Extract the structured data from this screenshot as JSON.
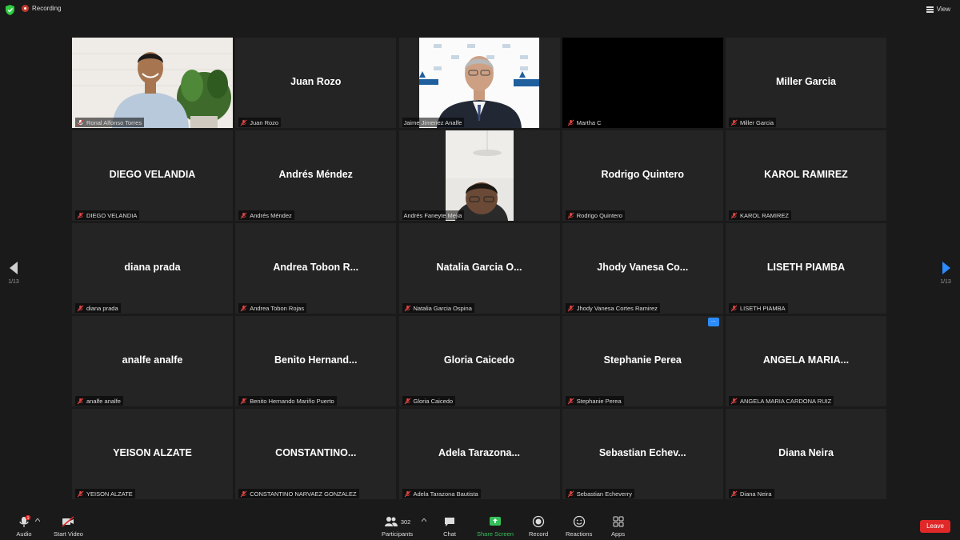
{
  "topbar": {
    "recording_label": "Recording",
    "view_label": "View"
  },
  "pager": {
    "page_left": "1/13",
    "page_right": "1/13"
  },
  "tiles": [
    {
      "big": "",
      "caption": "Ronal Alfonso Torres",
      "video": "ronal",
      "active": true,
      "mic": "on"
    },
    {
      "big": "Juan Rozo",
      "caption": "Juan Rozo",
      "mic": "off"
    },
    {
      "big": "",
      "caption": "Jaime Jimenez Analfe",
      "video": "jaime",
      "mic": "none"
    },
    {
      "big": "",
      "caption": "Martha C",
      "video": "black",
      "mic": "off"
    },
    {
      "big": "Miller Garcia",
      "caption": "Miller Garcia",
      "mic": "off"
    },
    {
      "big": "DIEGO VELANDIA",
      "caption": "DIEGO VELANDIA",
      "mic": "off"
    },
    {
      "big": "Andrés Méndez",
      "caption": "Andrés Méndez",
      "mic": "off"
    },
    {
      "big": "",
      "caption": "Andrés Faneyte Mejia",
      "video": "andres",
      "mic": "none"
    },
    {
      "big": "Rodrigo Quintero",
      "caption": "Rodrigo Quintero",
      "mic": "off"
    },
    {
      "big": "KAROL RAMIREZ",
      "caption": "KAROL RAMIREZ",
      "mic": "off"
    },
    {
      "big": "diana prada",
      "caption": "diana prada",
      "mic": "off"
    },
    {
      "big": "Andrea Tobon R...",
      "caption": "Andrea Tobon Rojas",
      "mic": "off"
    },
    {
      "big": "Natalia Garcia O...",
      "caption": "Natalia Garcia Ospina",
      "mic": "off"
    },
    {
      "big": "Jhody Vanesa Co...",
      "caption": "Jhody Vanesa Cortes Ramirez",
      "mic": "off"
    },
    {
      "big": "LISETH PIAMBA",
      "caption": "LISETH PIAMBA",
      "mic": "off"
    },
    {
      "big": "analfe analfe",
      "caption": "analfe analfe",
      "mic": "off"
    },
    {
      "big": "Benito Hernand...",
      "caption": "Benito Hernando Mariño Puerto",
      "mic": "off"
    },
    {
      "big": "Gloria Caicedo",
      "caption": "Gloria Caicedo",
      "mic": "off"
    },
    {
      "big": "Stephanie Perea",
      "caption": "Stephanie Perea",
      "mic": "off",
      "more": "..."
    },
    {
      "big": "ANGELA MARIA...",
      "caption": "ANGELA MARIA CARDONA RUIZ",
      "mic": "off"
    },
    {
      "big": "YEISON ALZATE",
      "caption": "YEISON ALZATE",
      "mic": "off"
    },
    {
      "big": "CONSTANTINO...",
      "caption": "CONSTANTINO NARVAEZ GONZALEZ",
      "mic": "off"
    },
    {
      "big": "Adela Tarazona...",
      "caption": "Adela Tarazona Bautista",
      "mic": "off"
    },
    {
      "big": "Sebastian Echev...",
      "caption": "Sebastian Echeverry",
      "mic": "off"
    },
    {
      "big": "Diana Neira",
      "caption": "Diana Neira",
      "mic": "off"
    }
  ],
  "toolbar": {
    "audio_label": "Audio",
    "start_video_label": "Start Video",
    "participants_label": "Participants",
    "participants_count": "302",
    "chat_label": "Chat",
    "share_screen_label": "Share Screen",
    "record_label": "Record",
    "reactions_label": "Reactions",
    "apps_label": "Apps",
    "leave_label": "Leave",
    "audio_badge": "1"
  },
  "colors": {
    "active_border": "#b7d84a",
    "share_green": "#35c05a",
    "leave_red": "#e02828",
    "accent_blue": "#2d8cff"
  }
}
